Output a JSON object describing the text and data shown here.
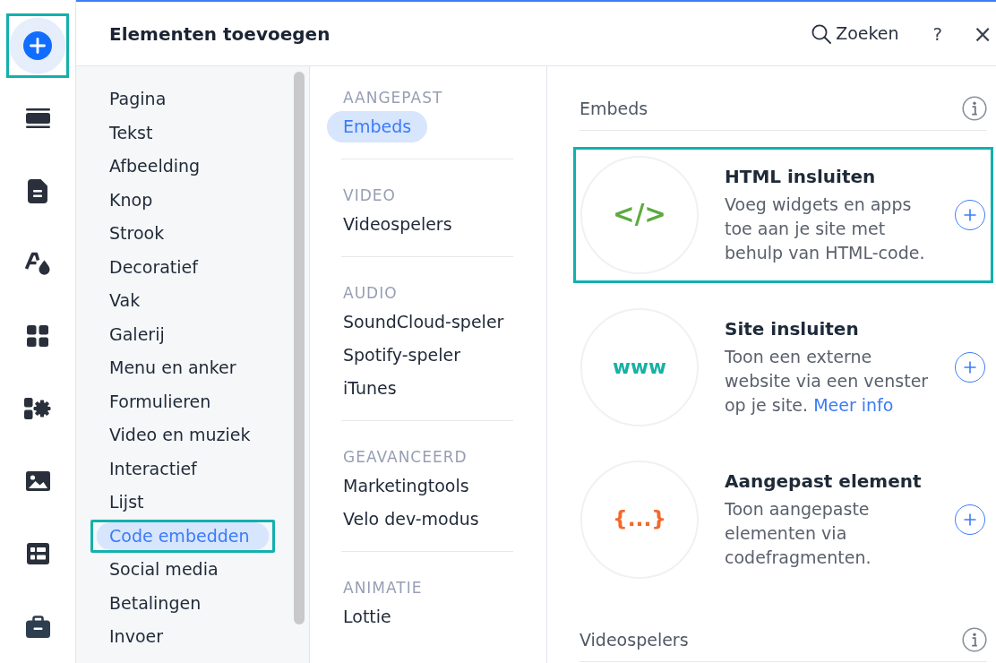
{
  "rail": {
    "items": [
      {
        "selected": true,
        "highlighted": true
      },
      {
        "selected": false,
        "highlighted": false
      },
      {
        "selected": false,
        "highlighted": false
      },
      {
        "selected": false,
        "highlighted": false
      },
      {
        "selected": false,
        "highlighted": false
      },
      {
        "selected": false,
        "highlighted": false
      },
      {
        "selected": false,
        "highlighted": false
      },
      {
        "selected": false,
        "highlighted": false
      },
      {
        "selected": false,
        "highlighted": false
      }
    ]
  },
  "header": {
    "title": "Elementen toevoegen",
    "search": "Zoeken",
    "help": "?",
    "close": "×"
  },
  "categories": {
    "items": [
      {
        "label": "Pagina",
        "selected": false,
        "highlighted": false
      },
      {
        "label": "Tekst",
        "selected": false,
        "highlighted": false
      },
      {
        "label": "Afbeelding",
        "selected": false,
        "highlighted": false
      },
      {
        "label": "Knop",
        "selected": false,
        "highlighted": false
      },
      {
        "label": "Strook",
        "selected": false,
        "highlighted": false
      },
      {
        "label": "Decoratief",
        "selected": false,
        "highlighted": false
      },
      {
        "label": "Vak",
        "selected": false,
        "highlighted": false
      },
      {
        "label": "Galerij",
        "selected": false,
        "highlighted": false
      },
      {
        "label": "Menu en anker",
        "selected": false,
        "highlighted": false
      },
      {
        "label": "Formulieren",
        "selected": false,
        "highlighted": false
      },
      {
        "label": "Video en muziek",
        "selected": false,
        "highlighted": false
      },
      {
        "label": "Interactief",
        "selected": false,
        "highlighted": false
      },
      {
        "label": "Lijst",
        "selected": false,
        "highlighted": false
      },
      {
        "label": "Code embedden",
        "selected": true,
        "highlighted": true
      },
      {
        "label": "Social media",
        "selected": false,
        "highlighted": false
      },
      {
        "label": "Betalingen",
        "selected": false,
        "highlighted": false
      },
      {
        "label": "Invoer",
        "selected": false,
        "highlighted": false
      }
    ]
  },
  "subcategories": {
    "sections": [
      {
        "heading": "AANGEPAST",
        "items": [
          {
            "label": "Embeds",
            "selected": true
          }
        ]
      },
      {
        "heading": "VIDEO",
        "items": [
          {
            "label": "Videospelers",
            "selected": false
          }
        ]
      },
      {
        "heading": "AUDIO",
        "items": [
          {
            "label": "SoundCloud-speler",
            "selected": false
          },
          {
            "label": "Spotify-speler",
            "selected": false
          },
          {
            "label": "iTunes",
            "selected": false
          }
        ]
      },
      {
        "heading": "GEAVANCEERD",
        "items": [
          {
            "label": "Marketingtools",
            "selected": false
          },
          {
            "label": "Velo dev-modus",
            "selected": false
          }
        ]
      },
      {
        "heading": "ANIMATIE",
        "items": [
          {
            "label": "Lottie",
            "selected": false
          }
        ]
      }
    ]
  },
  "content": {
    "sections": [
      {
        "title": "Embeds",
        "cards": [
          {
            "symbol": "</>",
            "color": "#5aab3f",
            "title": "HTML insluiten",
            "description": "Voeg widgets en apps toe aan je site met behulp van HTML-code.",
            "highlighted": true
          },
          {
            "symbol": "www",
            "color": "#15b2a5",
            "title": "Site insluiten",
            "description": "Toon een externe website via een venster op je site.",
            "link": "Meer info",
            "highlighted": false
          },
          {
            "symbol": "{...}",
            "color": "#f26a2a",
            "title": "Aangepast element",
            "description": "Toon aangepaste elementen via codefragmenten.",
            "highlighted": false
          }
        ]
      },
      {
        "title": "Videospelers"
      }
    ]
  }
}
